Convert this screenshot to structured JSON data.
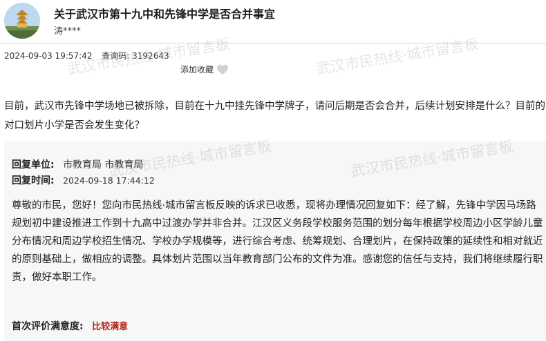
{
  "header": {
    "title": "关于武汉市第十九中和先锋中学是否合并事宜",
    "author": "涛****"
  },
  "meta": {
    "datetime": "2024-09-03 19:57:42",
    "query_label": "查询码:",
    "query_code": "3192643",
    "favorite_label": "添加收藏",
    "favorite_icon": "heart-icon"
  },
  "watermark": {
    "text": "武汉市民热线·城市留言板"
  },
  "question": {
    "text": "目前，武汉市先锋中学场地已被拆除，目前在十九中挂先锋中学牌子，请问后期是否会合并，后续计划安排是什么？目前的对口划片小学是否会发生变化？"
  },
  "reply": {
    "unit_label": "回复单位:",
    "unit_value": "市教育局 市教育局",
    "time_label": "回复时间:",
    "time_value": "2024-09-18 17:44:12",
    "body": "尊敬的市民，您好！您向市民热线·城市留言板反映的诉求已收悉，现将办理情况回复如下：经了解，先锋中学因马场路规划初中建设推进工作到十九高中过渡办学并非合并。江汉区义务段学校服务范围的划分每年根据学校周边小区学龄儿童分布情况和周边学校招生情况、学校办学规模等，进行综合考虑、统筹规划、合理划片，在保持政策的延续性和相对就近的原则基础上，做相应的调整。具体划片范围以当年教育部门公布的文件为准。感谢您的信任与支持，我们将继续履行职责，做好本职工作。"
  },
  "rating": {
    "label": "首次评价满意度:",
    "value": "比较满意",
    "value_color": "#b1261c"
  }
}
